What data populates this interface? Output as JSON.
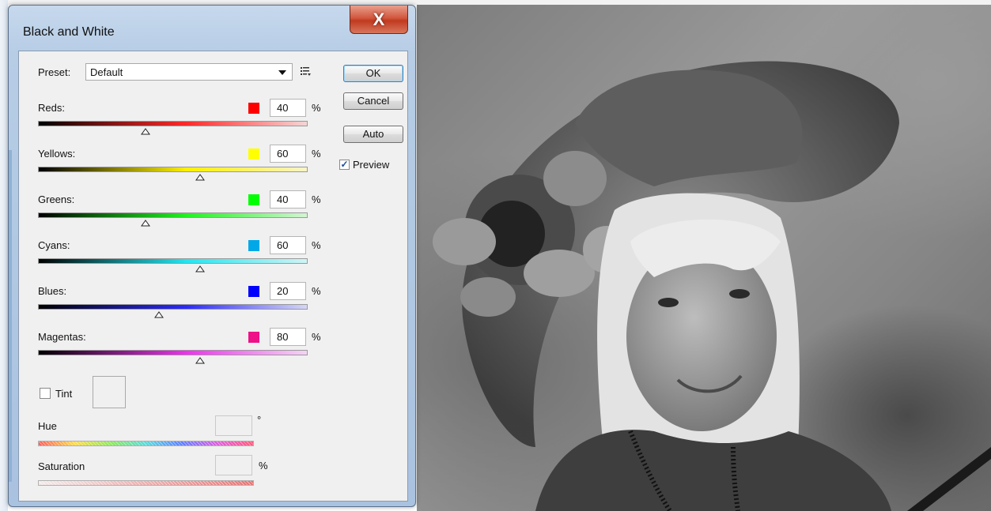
{
  "dialog": {
    "title": "Black and White",
    "close_label": "X"
  },
  "preset": {
    "label": "Preset:",
    "value": "Default"
  },
  "buttons": {
    "ok": "OK",
    "cancel": "Cancel",
    "auto": "Auto"
  },
  "preview": {
    "label": "Preview",
    "checked": true,
    "check_glyph": "✓"
  },
  "channels": [
    {
      "label": "Reds:",
      "value": "40",
      "unit": "%",
      "swatch": "#ff0000",
      "track_colors": [
        "#000000",
        "#ff2a2a",
        "#f4d6d6"
      ],
      "level": 0.4
    },
    {
      "label": "Yellows:",
      "value": "60",
      "unit": "%",
      "swatch": "#ffff00",
      "track_colors": [
        "#000000",
        "#fdf000",
        "#f8f4c8"
      ],
      "level": 0.6
    },
    {
      "label": "Greens:",
      "value": "40",
      "unit": "%",
      "swatch": "#00ff00",
      "track_colors": [
        "#000000",
        "#22f022",
        "#d4f4d4"
      ],
      "level": 0.4
    },
    {
      "label": "Cyans:",
      "value": "60",
      "unit": "%",
      "swatch": "#00a8e8",
      "track_colors": [
        "#000000",
        "#22e6f0",
        "#d0f4f6"
      ],
      "level": 0.6
    },
    {
      "label": "Blues:",
      "value": "20",
      "unit": "%",
      "swatch": "#0000ff",
      "track_colors": [
        "#000000",
        "#2a2aff",
        "#d6d6f6"
      ],
      "level": 0.45
    },
    {
      "label": "Magentas:",
      "value": "80",
      "unit": "%",
      "swatch": "#ee1188",
      "track_colors": [
        "#000000",
        "#f030f0",
        "#f4d4f4"
      ],
      "level": 0.6
    }
  ],
  "tint": {
    "label": "Tint",
    "checked": false
  },
  "hue": {
    "label": "Hue",
    "value": "",
    "unit": "°"
  },
  "saturation": {
    "label": "Saturation",
    "value": "",
    "unit": "%"
  },
  "icons": {
    "close": "close-icon",
    "dropdown": "chevron-down-icon",
    "preset_menu": "preset-options-icon",
    "checkmark": "checkmark-icon"
  }
}
